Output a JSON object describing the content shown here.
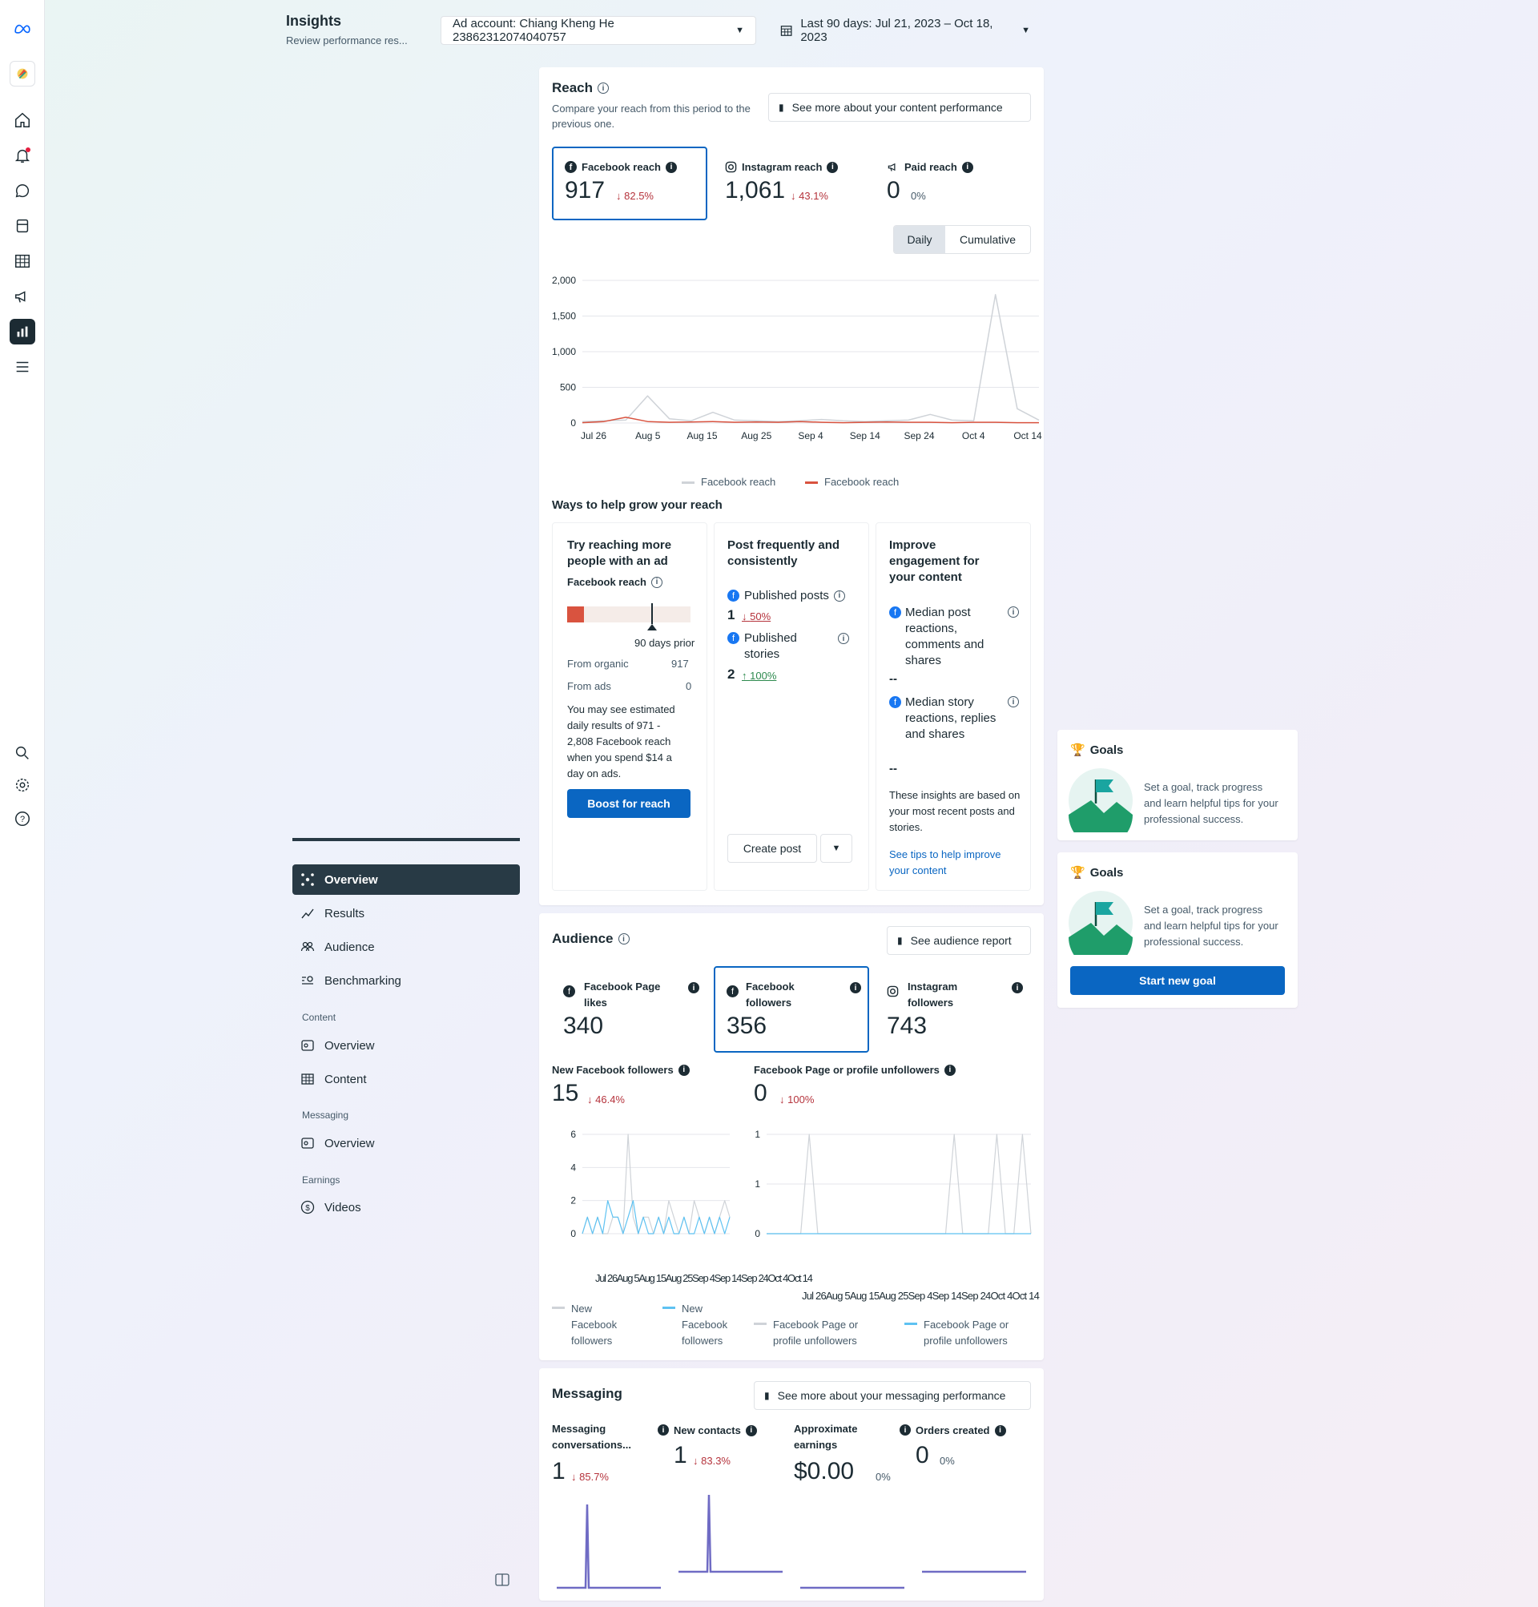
{
  "header": {
    "title": "Insights",
    "subtitle": "Review performance res...",
    "ad_account": "Ad account: Chiang Kheng He 23862312074040757",
    "date_range": "Last 90 days: Jul 21, 2023 – Oct 18, 2023"
  },
  "sidebar": {
    "items": [
      {
        "label": "Overview"
      },
      {
        "label": "Results"
      },
      {
        "label": "Audience"
      },
      {
        "label": "Benchmarking"
      }
    ],
    "content_section": "Content",
    "content_items": [
      {
        "label": "Overview"
      },
      {
        "label": "Content"
      }
    ],
    "messaging_section": "Messaging",
    "messaging_items": [
      {
        "label": "Overview"
      }
    ],
    "earnings_section": "Earnings",
    "earnings_items": [
      {
        "label": "Videos"
      }
    ]
  },
  "reach": {
    "title": "Reach",
    "description": "Compare your reach from this period to the previous one.",
    "see_more": "See more about your content performance",
    "metrics": [
      {
        "label": "Facebook reach",
        "value": "917",
        "change": "82.5%",
        "direction": "down"
      },
      {
        "label": "Instagram reach",
        "value": "1,061",
        "change": "43.1%",
        "direction": "down"
      },
      {
        "label": "Paid reach",
        "value": "0",
        "change": "0%",
        "direction": "none"
      }
    ],
    "toggle": {
      "daily": "Daily",
      "cumulative": "Cumulative"
    },
    "legend": [
      "Facebook reach",
      "Facebook reach"
    ],
    "ways_title": "Ways to help grow your reach"
  },
  "chart_data": [
    {
      "type": "line",
      "x": [
        "Jul 26",
        "Aug 5",
        "Aug 15",
        "Aug 25",
        "Sep 4",
        "Sep 14",
        "Sep 24",
        "Oct 4",
        "Oct 14"
      ],
      "ylim": [
        0,
        2000
      ],
      "yticks": [
        "2,000",
        "1,500",
        "1,000",
        "500",
        "0"
      ],
      "series": [
        {
          "name": "Facebook reach",
          "color": "#cfd3d8",
          "values": [
            20,
            30,
            40,
            380,
            60,
            30,
            150,
            40,
            30,
            20,
            30,
            50,
            30,
            20,
            30,
            40,
            120,
            40,
            30,
            1800,
            200,
            40
          ]
        },
        {
          "name": "Facebook reach",
          "color": "#d9533f",
          "values": [
            5,
            20,
            80,
            20,
            10,
            15,
            20,
            10,
            15,
            10,
            20,
            10,
            5,
            10,
            15,
            10,
            10,
            5,
            10,
            10,
            5,
            5
          ]
        }
      ]
    },
    {
      "type": "line",
      "ylim": [
        0,
        6
      ],
      "yticks": [
        "6",
        "4",
        "2",
        "0"
      ],
      "x_labels": "Jul 26Aug 5Aug 15Aug 25Sep 4Sep 14Sep 24Oct 4Oct 14",
      "series": [
        {
          "name": "New Facebook followers",
          "color": "#cfd3d8",
          "values": [
            0,
            1,
            0,
            1,
            0,
            0,
            1,
            1,
            0,
            6,
            1,
            0,
            1,
            1,
            0,
            1,
            0,
            2,
            1,
            0,
            1,
            0,
            2,
            1,
            0,
            1,
            0,
            1,
            2,
            1
          ]
        },
        {
          "name": "New Facebook followers",
          "color": "#5ec2f2",
          "values": [
            0,
            1,
            0,
            1,
            0,
            2,
            1,
            1,
            0,
            1,
            2,
            0,
            1,
            0,
            0,
            1,
            0,
            1,
            0,
            0,
            1,
            0,
            0,
            1,
            0,
            1,
            0,
            1,
            0,
            1
          ]
        }
      ]
    },
    {
      "type": "line",
      "ylim": [
        0,
        1
      ],
      "yticks": [
        "1",
        "1",
        "0"
      ],
      "x_labels": "Jul 26Aug 5Aug 15Aug 25Sep 4Sep 14Sep 24Oct 4Oct 14",
      "series": [
        {
          "name": "Facebook Page or profile unfollowers",
          "color": "#cfd3d8",
          "values": [
            0,
            0,
            0,
            0,
            0,
            1,
            0,
            0,
            0,
            0,
            0,
            0,
            0,
            0,
            0,
            0,
            0,
            0,
            0,
            0,
            0,
            0,
            1,
            0,
            0,
            0,
            0,
            1,
            0,
            0,
            1,
            0
          ]
        },
        {
          "name": "Facebook Page or profile unfollowers",
          "color": "#5ec2f2",
          "values": [
            0,
            0,
            0,
            0,
            0,
            0,
            0,
            0,
            0,
            0,
            0,
            0,
            0,
            0,
            0,
            0,
            0,
            0,
            0,
            0,
            0,
            0,
            0,
            0,
            0,
            0,
            0,
            0,
            0,
            0,
            0,
            0
          ]
        }
      ]
    }
  ],
  "tips": {
    "ad": {
      "title": "Try reaching more people with an ad",
      "metric": "Facebook reach",
      "prior_label": "90 days prior",
      "organic_label": "From organic",
      "organic_value": "917",
      "ads_label": "From ads",
      "ads_value": "0",
      "estimate_text": "You may see estimated daily results of 971 - 2,808 Facebook reach when you spend $14 a day on ads.",
      "boost": "Boost for reach"
    },
    "post": {
      "title": "Post frequently and consistently",
      "published_posts": "Published posts",
      "posts_value": "1",
      "posts_change": "50%",
      "published_stories": "Published stories",
      "stories_value": "2",
      "stories_change": "100%",
      "create_post": "Create post"
    },
    "engagement": {
      "title": "Improve engagement for your content",
      "median_post": "Median post reactions, comments and shares",
      "median_post_value": "--",
      "median_story": "Median story reactions, replies and shares",
      "median_story_value": "--",
      "note": "These insights are based on your most recent posts and stories.",
      "link": "See tips to help improve your content"
    }
  },
  "goals": {
    "title": "Goals",
    "text": "Set a goal, track progress and learn helpful tips for your professional success.",
    "button": "Start new goal"
  },
  "audience": {
    "title": "Audience",
    "report": "See audience report",
    "metrics": [
      {
        "label": "Facebook Page likes",
        "value": "340"
      },
      {
        "label": "Facebook followers",
        "value": "356"
      },
      {
        "label": "Instagram followers",
        "value": "743"
      }
    ],
    "new_followers_label": "New Facebook followers",
    "new_followers_value": "15",
    "new_followers_change": "46.4%",
    "unfollowers_label": "Facebook Page or profile unfollowers",
    "unfollowers_value": "0",
    "unfollowers_change": "100%",
    "legend_new": [
      "New Facebook followers",
      "New Facebook followers"
    ],
    "legend_unf": [
      "Facebook Page or profile unfollowers",
      "Facebook Page or profile unfollowers"
    ]
  },
  "messaging": {
    "title": "Messaging",
    "see_more": "See more about your messaging performance",
    "metrics": [
      {
        "label": "Messaging conversations...",
        "value": "1",
        "change": "85.7%"
      },
      {
        "label": "New contacts",
        "value": "1",
        "change": "83.3%"
      },
      {
        "label": "Approximate earnings",
        "value": "$0.00",
        "change": "0%"
      },
      {
        "label": "Orders created",
        "value": "0",
        "change": "0%"
      }
    ]
  },
  "colors": {
    "accent": "#0a66c2",
    "nav_active": "#283a45",
    "down": "#b5333c",
    "up": "#2d8a4e",
    "reach_red": "#d9533f",
    "followers_blue": "#5ec2f2",
    "messaging_purple": "#6f6bc4"
  }
}
